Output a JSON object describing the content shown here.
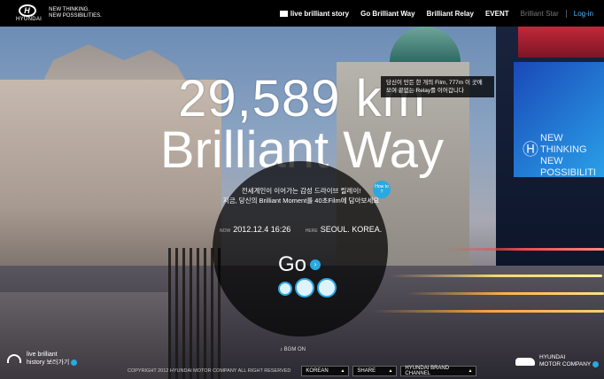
{
  "brand": {
    "logo_text": "HYUNDAI",
    "tagline_line1": "NEW THINKING.",
    "tagline_line2": "NEW POSSIBILITIES."
  },
  "nav": {
    "items": [
      {
        "label": "live brilliant story"
      },
      {
        "label": "Go Brilliant Way"
      },
      {
        "label": "Brilliant Relay"
      },
      {
        "label": "EVENT"
      },
      {
        "label": "Brilliant Star"
      }
    ],
    "login": "Log-in"
  },
  "hero": {
    "distance": "29,589 km",
    "title": "Brilliant Way"
  },
  "tooltip": {
    "line1": "당신이 만든 한 개의 Film, 777m 이 곳에",
    "line2": "모여 끝없는 Relay를 이어갑니다"
  },
  "panel": {
    "line1": "전세계인이 이어가는 감성 드라이브 릴레이!",
    "line2": "지금, 당신의 Brilliant Moment를 40초Film에 담아보세요",
    "howto": "How to",
    "now_label": "NOW",
    "now_value": "2012.12.4 16:26",
    "here_label": "HERE",
    "here_value": "SEOUL. KOREA.",
    "go": "Go"
  },
  "bgm": "BGM ON",
  "bottom_left": {
    "line1": "live brilliant",
    "line2": "history 보러가기"
  },
  "bottom_right": {
    "line1": "HYUNDAI",
    "line2": "MOTOR COMPANY"
  },
  "billboard": {
    "line1": "NEW THINKING",
    "line2": "NEW POSSIBILITI"
  },
  "footer": {
    "copyright": "COPYRIGHT 2012 HYUNDAI MOTOR COMPANY ALL RIGHT RESERVED",
    "language": "KOREAN",
    "share": "SHARE",
    "channel": "HYUNDAI BRAND CHANNEL"
  }
}
